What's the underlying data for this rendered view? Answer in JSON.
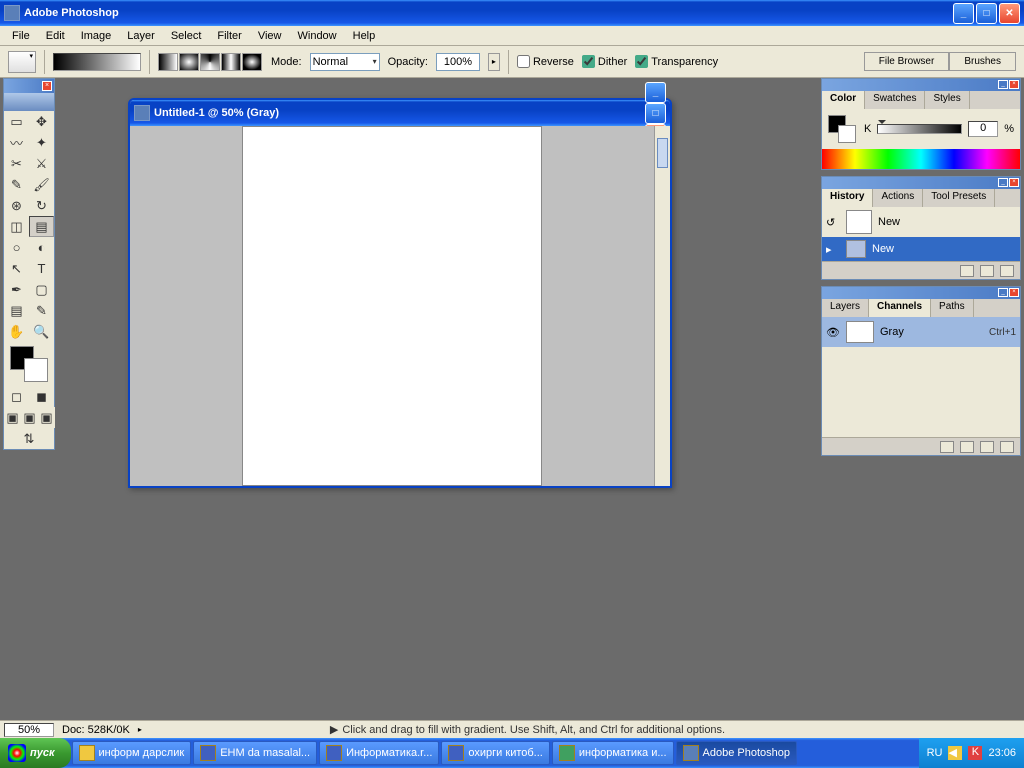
{
  "app": {
    "title": "Adobe Photoshop"
  },
  "menu": [
    "File",
    "Edit",
    "Image",
    "Layer",
    "Select",
    "Filter",
    "View",
    "Window",
    "Help"
  ],
  "options": {
    "mode_label": "Mode:",
    "mode_value": "Normal",
    "opacity_label": "Opacity:",
    "opacity_value": "100%",
    "reverse_label": "Reverse",
    "dither_label": "Dither",
    "transparency_label": "Transparency",
    "palette_tabs": [
      "File Browser",
      "Brushes"
    ]
  },
  "document": {
    "title": "Untitled-1 @ 50% (Gray)"
  },
  "color_panel": {
    "tabs": [
      "Color",
      "Swatches",
      "Styles"
    ],
    "channel": "K",
    "value": "0",
    "pct": "%"
  },
  "history_panel": {
    "tabs": [
      "History",
      "Actions",
      "Tool Presets"
    ],
    "doc_name": "New",
    "items": [
      {
        "label": "New",
        "selected": true
      }
    ]
  },
  "layers_panel": {
    "tabs": [
      "Layers",
      "Channels",
      "Paths"
    ],
    "active_tab": 1,
    "channels": [
      {
        "name": "Gray",
        "shortcut": "Ctrl+1"
      }
    ]
  },
  "status": {
    "zoom": "50%",
    "doc_info": "Doc: 528K/0K",
    "hint": "Click and drag to fill with gradient. Use Shift, Alt, and Ctrl for additional options."
  },
  "taskbar": {
    "start": "пуск",
    "items": [
      {
        "label": "информ дарслик",
        "icon": "folder"
      },
      {
        "label": "EHM da masalal...",
        "icon": "word",
        "active": false
      },
      {
        "label": "Информатика.r...",
        "icon": "word"
      },
      {
        "label": "охирги китоб...",
        "icon": "word"
      },
      {
        "label": "информатика и...",
        "icon": "excel"
      },
      {
        "label": "Adobe Photoshop",
        "icon": "ps",
        "active": true
      }
    ],
    "lang": "RU",
    "time": "23:06"
  }
}
